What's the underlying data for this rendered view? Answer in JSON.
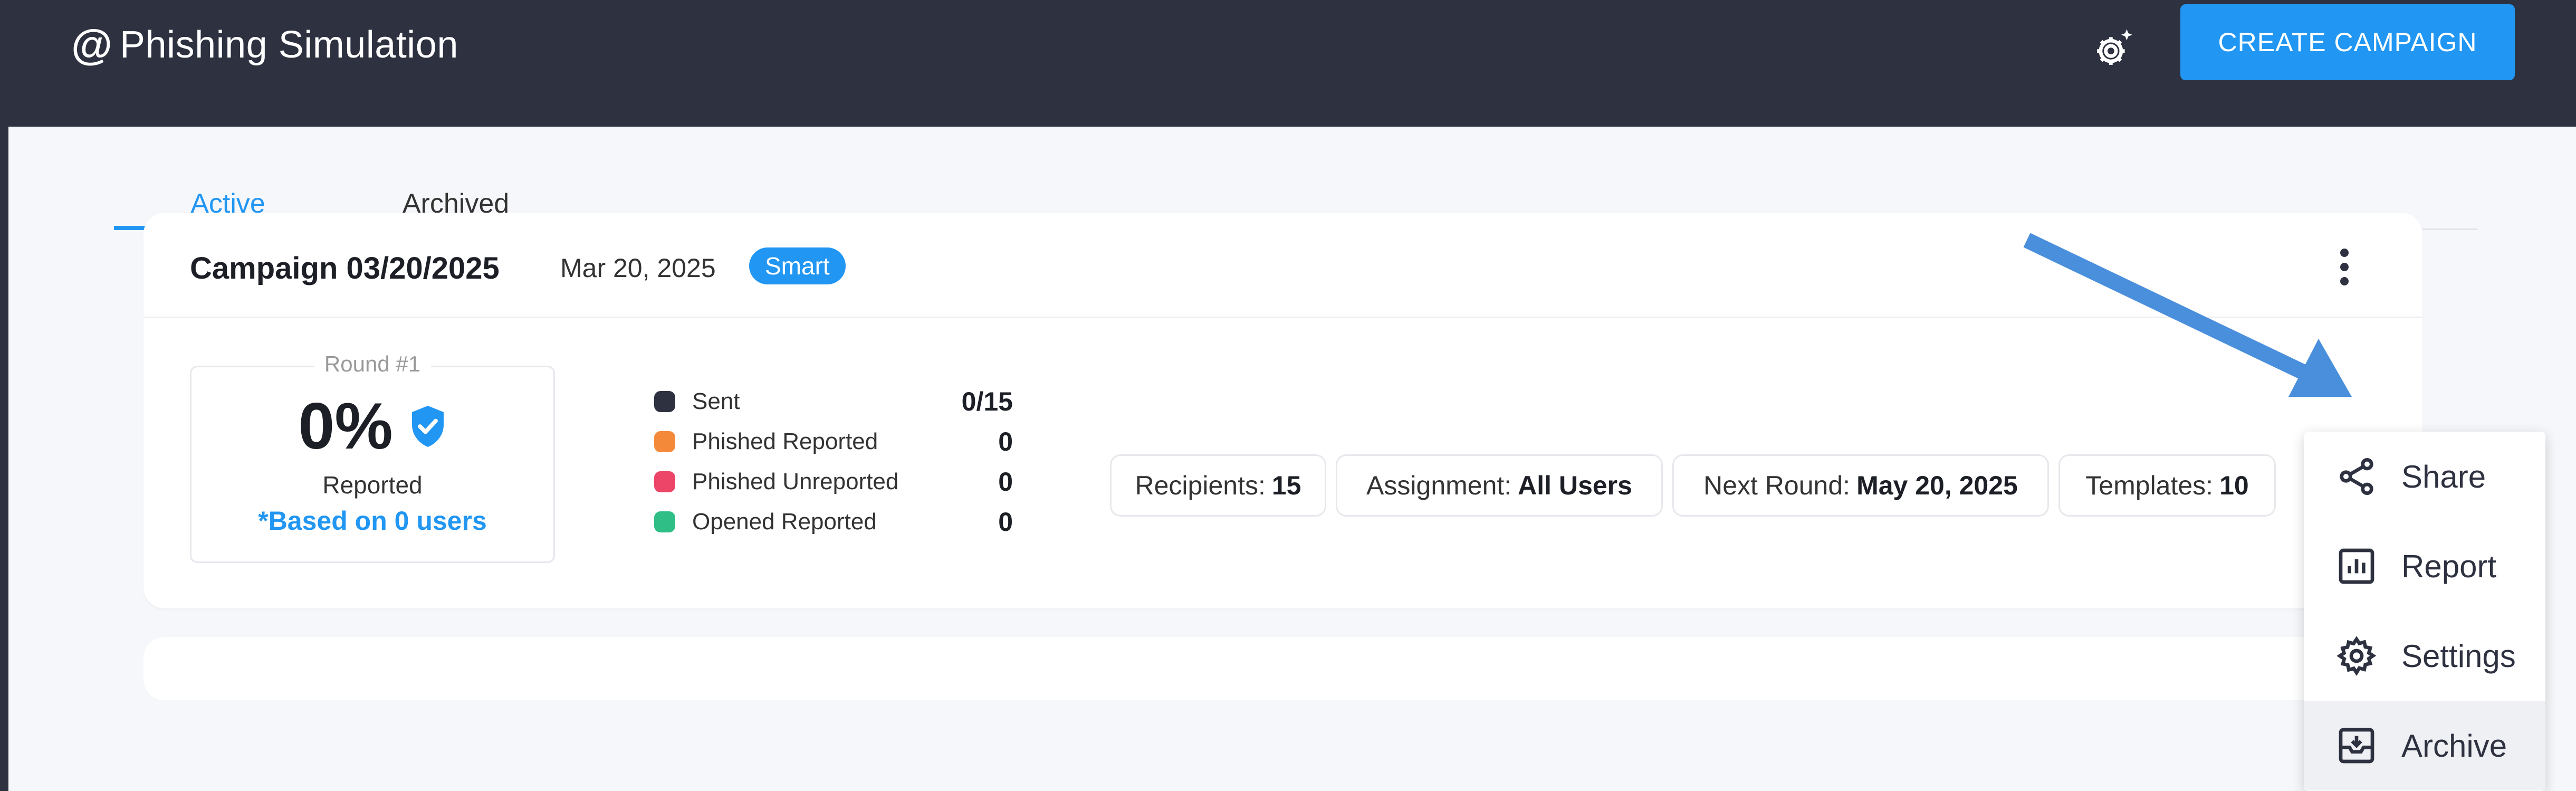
{
  "header": {
    "brand_icon": "@",
    "title": "Phishing Simulation",
    "settings_icon": "gear-sparkle-icon",
    "create_button": "CREATE CAMPAIGN"
  },
  "tabs": [
    {
      "label": "Active",
      "active": true
    },
    {
      "label": "Archived",
      "active": false
    }
  ],
  "campaign": {
    "name": "Campaign 03/20/2025",
    "date": "Mar 20, 2025",
    "badge": "Smart",
    "round": {
      "label": "Round #1",
      "percent": "0%",
      "percent_label": "Reported",
      "note": "*Based on 0 users"
    },
    "stats": [
      {
        "label": "Sent",
        "value": "0/15",
        "color": "#2d3140"
      },
      {
        "label": "Phished Reported",
        "value": "0",
        "color": "#f5893a"
      },
      {
        "label": "Phished Unreported",
        "value": "0",
        "color": "#ec4568"
      },
      {
        "label": "Opened Reported",
        "value": "0",
        "color": "#2fbe86"
      }
    ],
    "chips": [
      {
        "label": "Recipients:",
        "value": "15"
      },
      {
        "label": "Assignment:",
        "value": "All Users"
      },
      {
        "label": "Next Round:",
        "value": "May 20, 2025"
      },
      {
        "label": "Templates:",
        "value": "10"
      }
    ]
  },
  "menu": {
    "items": [
      {
        "label": "Share",
        "icon": "share-icon"
      },
      {
        "label": "Report",
        "icon": "report-chart-icon"
      },
      {
        "label": "Settings",
        "icon": "gear-icon"
      },
      {
        "label": "Archive",
        "icon": "archive-icon"
      }
    ]
  },
  "colors": {
    "accent": "#2196f3",
    "header_bg": "#2d3140",
    "arrow": "#4a8fdc"
  }
}
